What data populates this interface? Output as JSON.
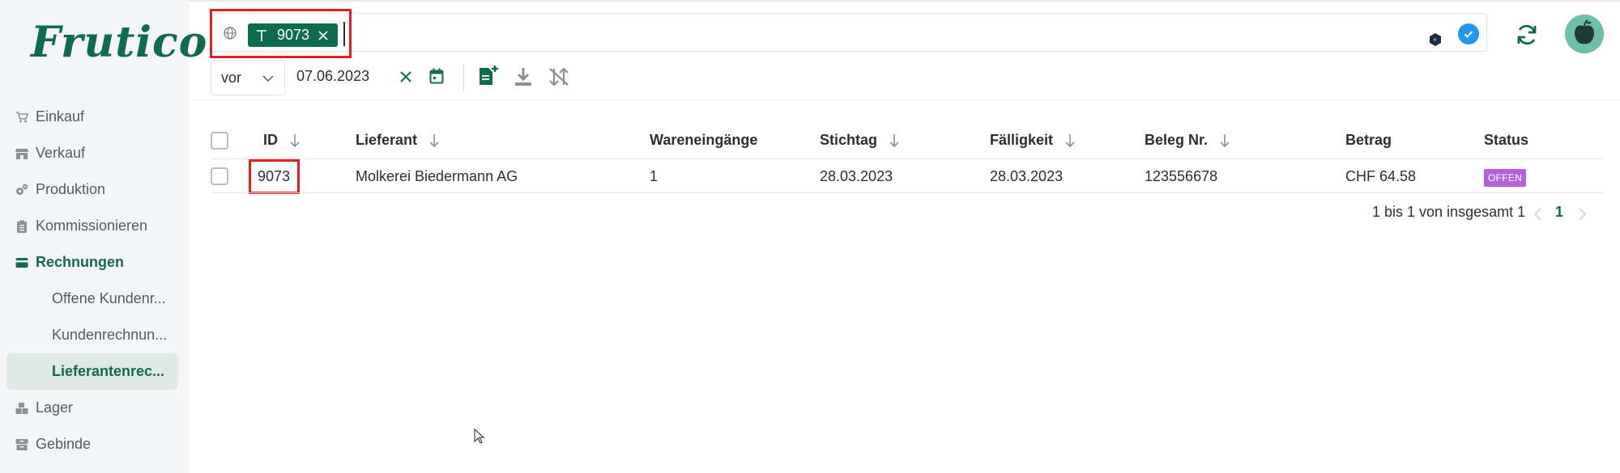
{
  "app": {
    "logo_text": "Frutico"
  },
  "sidebar": {
    "items": [
      {
        "label": "Einkauf",
        "icon": "cart-icon"
      },
      {
        "label": "Verkauf",
        "icon": "store-icon"
      },
      {
        "label": "Produktion",
        "icon": "cogs-icon"
      },
      {
        "label": "Kommissionieren",
        "icon": "clipboard-icon"
      },
      {
        "label": "Rechnungen",
        "icon": "credit-card-icon",
        "active": true
      },
      {
        "label": "Offene Kundenr...",
        "sub": true
      },
      {
        "label": "Kundenrechnun...",
        "sub": true
      },
      {
        "label": "Lieferantenrec...",
        "sub": true,
        "selected": true
      },
      {
        "label": "Lager",
        "icon": "boxes-icon"
      },
      {
        "label": "Gebinde",
        "icon": "archive-icon"
      }
    ]
  },
  "search": {
    "chip_value": "9073"
  },
  "filter": {
    "operator": "vor",
    "date": "07.06.2023"
  },
  "table": {
    "columns": [
      "ID",
      "Lieferant",
      "Wareneingänge",
      "Stichtag",
      "Fälligkeit",
      "Beleg Nr.",
      "Betrag",
      "Status"
    ],
    "rows": [
      {
        "id": "9073",
        "lieferant": "Molkerei Biedermann AG",
        "wareneingaenge": "1",
        "stichtag": "28.03.2023",
        "faelligkeit": "28.03.2023",
        "beleg_nr": "123556678",
        "betrag": "CHF 64.58",
        "status": "OFFEN"
      }
    ]
  },
  "pagination": {
    "summary": "1 bis 1 von insgesamt 1",
    "current_page": "1"
  },
  "colors": {
    "brand": "#0f6b4f",
    "status_offen": "#b561d8",
    "check_blue": "#2196f3",
    "highlight_red": "#e02020"
  }
}
